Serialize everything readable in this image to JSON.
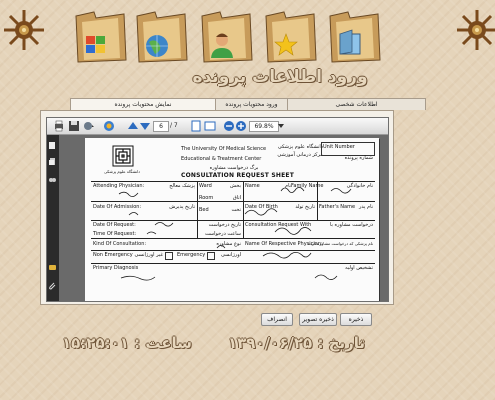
{
  "header": {
    "title": "ورود اطلاعات پرونده",
    "folders": [
      {
        "name": "windows-logo-folder",
        "icon": "windows-logo-icon"
      },
      {
        "name": "globe-folder",
        "icon": "globe-icon"
      },
      {
        "name": "user-folder",
        "icon": "user-icon"
      },
      {
        "name": "star-folder",
        "icon": "star-icon"
      },
      {
        "name": "window-folder",
        "icon": "window-icon"
      }
    ]
  },
  "tabs": [
    {
      "label": "اطلاعات شخصی"
    },
    {
      "label": "ورود محتویات پرونده"
    },
    {
      "label": "نمایش محتویات پرونده"
    }
  ],
  "viewer": {
    "page_current": "6",
    "page_total": "/ 7",
    "zoom": "69.8%"
  },
  "document": {
    "univ_en": "The University Of Medical Science",
    "center_en": "Educational  & Treatment Center",
    "univ_fa": "دانشگاه علوم پزشکی",
    "center_fa": "مرکز درمانی آموزشی",
    "form_fa": "برگ درخواست مشاوره",
    "title": "CONSULTATION REQUEST SHEET",
    "unit_number": "Unit Number",
    "unit_number_fa": "شماره پرونده",
    "attending": "Attending Physician:",
    "attending_fa": "پزشک معالج",
    "ward": "Ward",
    "ward_fa": "بخش",
    "room": "Room",
    "room_fa": "اتاق",
    "bed": "Bed",
    "bed_fa": "تخت",
    "name": "Name",
    "name_fa": "نام",
    "family": "Family Name",
    "family_fa": "نام خانوادگی",
    "admission": "Date Of Admission:",
    "admission_fa": "تاریخ پذیرش",
    "dob": "Date Of Birth",
    "dob_fa": "تاریخ تولد",
    "father": "Father's Name",
    "father_fa": "نام پدر",
    "date_req": "Date Of Request:",
    "date_req_fa": "تاریخ درخواست",
    "time_req": "Time Of Request:",
    "time_req_fa": "ساعت درخواست",
    "consult_with": "Consultation Request With",
    "consult_with_fa": "درخواست مشاوره با",
    "kind": "Kind Of Consultation:",
    "kind_fa": "نوع مشاوره",
    "non_emergency": "Non Emergency",
    "non_emergency_fa": "غیر اورژانسی",
    "emergency": "Emergency",
    "emergency_fa": "اورژانسی",
    "resp_physician": "Name Of Respective Physician:",
    "resp_physician_fa": "نام پزشکی که درخواست مشاوره کرده",
    "primary_dx": "Primary Diagnosis",
    "primary_dx_fa": "تشخیص اولیه"
  },
  "buttons": {
    "back": "ذخیره",
    "save_image": "ذخیره تصویر",
    "cancel": "انصراف"
  },
  "footer": {
    "date_label": "تاریخ :",
    "date_value": "۱۳۹۰/۰۶/۲۵",
    "time_label": "ساعت :",
    "time_value": "۱۵:۲۵:۰۱"
  },
  "colors": {
    "background": "#e5d4ba",
    "title_fill": "#e7d7bd",
    "title_outline": "#6e5337"
  }
}
